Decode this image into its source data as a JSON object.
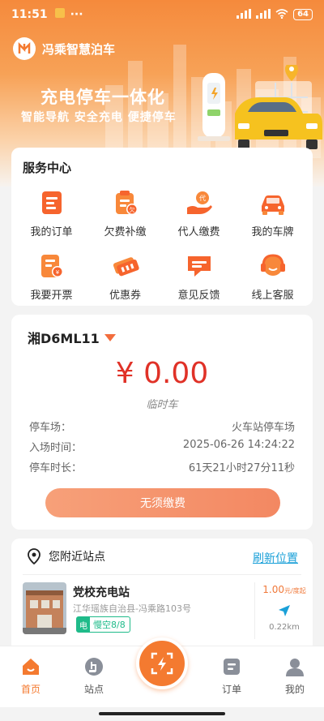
{
  "status_bar": {
    "time": "11:51",
    "battery": "64"
  },
  "brand": {
    "name": "冯乘智慧泊车"
  },
  "banner": {
    "slogan": "充电停车一体化",
    "sub": "智能导航  安全充电  便捷停车"
  },
  "service_center": {
    "title": "服务中心",
    "items": [
      {
        "label": "我的订单",
        "icon": "order-icon"
      },
      {
        "label": "欠费补缴",
        "icon": "arrears-icon"
      },
      {
        "label": "代人缴费",
        "icon": "pay-for-others-icon"
      },
      {
        "label": "我的车牌",
        "icon": "car-icon"
      },
      {
        "label": "我要开票",
        "icon": "invoice-icon"
      },
      {
        "label": "优惠券",
        "icon": "coupon-icon"
      },
      {
        "label": "意见反馈",
        "icon": "feedback-icon"
      },
      {
        "label": "线上客服",
        "icon": "customer-service-icon"
      }
    ]
  },
  "parking": {
    "plate": "湘D6ML11",
    "fee": "¥ 0.00",
    "fee_type": "临时车",
    "lot_label": "停车场：",
    "lot_value": "火车站停车场",
    "entry_label": "入场时间：",
    "entry_value": "2025-06-26 14:24:22",
    "duration_label": "停车时长：",
    "duration_value": "61天21小时27分11秒",
    "pay_button": "无须缴费"
  },
  "nearby": {
    "title": "您附近站点",
    "refresh": "刷新位置",
    "station": {
      "name": "党校充电站",
      "address": "江华瑶族自治县-冯乘路103号",
      "tag_icon": "电",
      "tag": "慢空8/8",
      "price": "1.00",
      "price_unit": "元/度起",
      "distance": "0.22km"
    }
  },
  "tabbar": {
    "home": "首页",
    "station": "站点",
    "orders": "订单",
    "mine": "我的"
  },
  "colors": {
    "accent": "#f47a30",
    "fee": "#e03127",
    "link": "#1aa0d8",
    "tag": "#1fbb8a"
  }
}
